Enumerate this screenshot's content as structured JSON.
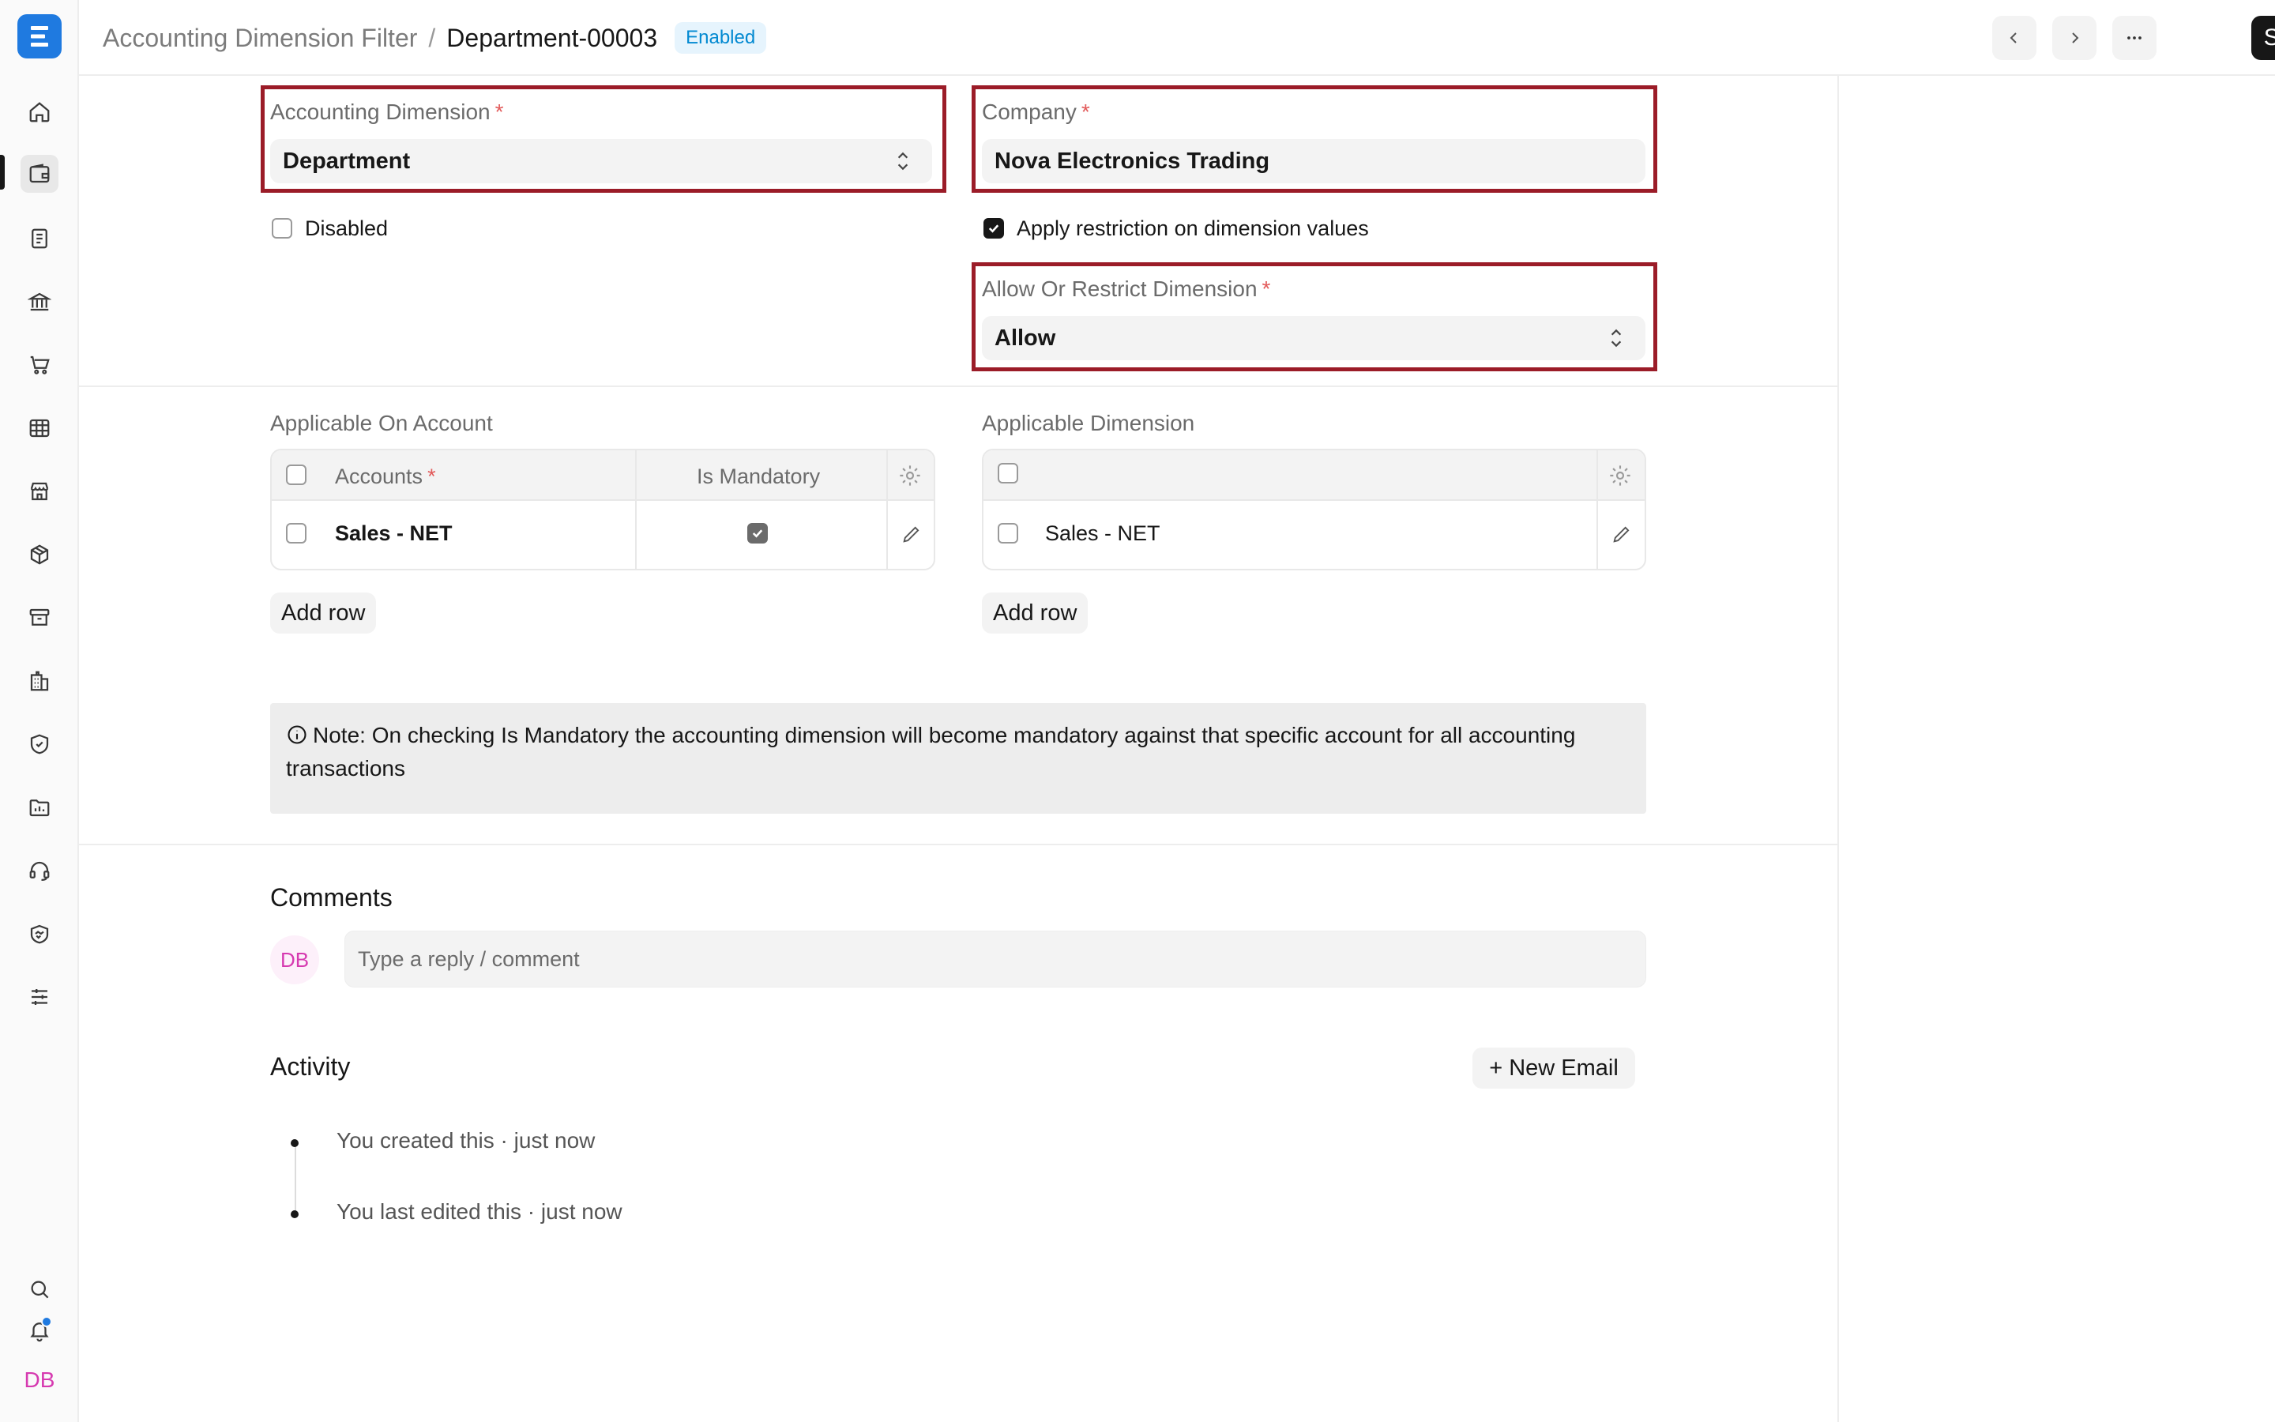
{
  "header": {
    "parent": "Accounting Dimension Filter",
    "separator": "/",
    "current": "Department-00003",
    "status_badge": "Enabled",
    "save_label": "Save"
  },
  "sidebar": {
    "avatar_initials": "DB",
    "icons": [
      "home-icon",
      "wallet-icon",
      "invoice-icon",
      "bank-icon",
      "cart-icon",
      "table-icon",
      "store-icon",
      "package-icon",
      "archive-icon",
      "building-icon",
      "shield-icon",
      "chart-folder-icon",
      "headset-icon",
      "handshake-icon",
      "sliders-icon"
    ]
  },
  "form": {
    "accounting_dimension": {
      "label": "Accounting Dimension",
      "required": "*",
      "value": "Department"
    },
    "company": {
      "label": "Company",
      "required": "*",
      "value": "Nova Electronics Trading"
    },
    "disabled": {
      "label": "Disabled",
      "checked": false
    },
    "apply_restriction": {
      "label": "Apply restriction on dimension values",
      "checked": true
    },
    "allow_or_restrict": {
      "label": "Allow Or Restrict Dimension",
      "required": "*",
      "value": "Allow"
    }
  },
  "applicable_on_account": {
    "label": "Applicable On Account",
    "columns": {
      "accounts": "Accounts",
      "required": "*",
      "is_mandatory": "Is Mandatory"
    },
    "rows": [
      {
        "account": "Sales - NET",
        "is_mandatory": true
      }
    ],
    "add_row": "Add row"
  },
  "applicable_dimension": {
    "label": "Applicable Dimension",
    "rows": [
      {
        "value": "Sales - NET"
      }
    ],
    "add_row": "Add row"
  },
  "note": "Note: On checking Is Mandatory the accounting dimension will become mandatory against that specific account for all accounting transactions",
  "comments": {
    "title": "Comments",
    "avatar": "DB",
    "placeholder": "Type a reply / comment"
  },
  "activity": {
    "title": "Activity",
    "new_email": "+ New Email",
    "items": [
      "You created this · just now",
      "You last edited this · just now"
    ]
  },
  "colors": {
    "highlight": "#9b1c28",
    "brand": "#1f7ae0",
    "badge_text": "#0289d1",
    "avatar_pink": "#d63ab0"
  }
}
